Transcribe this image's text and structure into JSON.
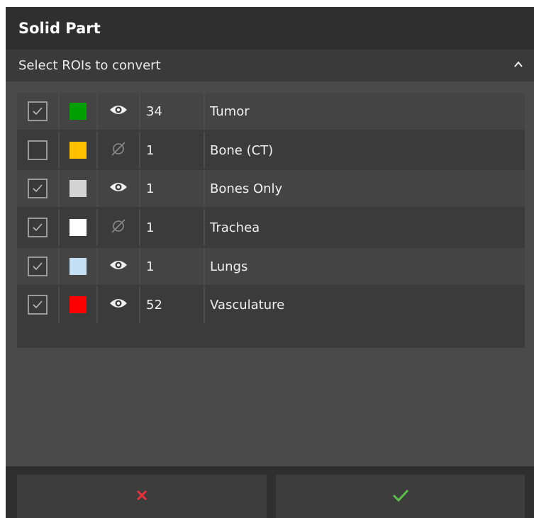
{
  "panel": {
    "title": "Solid Part"
  },
  "section": {
    "label": "Select ROIs to convert",
    "collapse_icon": "chevron-up-icon"
  },
  "rois": [
    {
      "checked": true,
      "color": "#00a000",
      "visible": true,
      "count": "34",
      "name": "Tumor"
    },
    {
      "checked": false,
      "color": "#ffc000",
      "visible": false,
      "count": "1",
      "name": "Bone (CT)"
    },
    {
      "checked": true,
      "color": "#d3d3d3",
      "visible": true,
      "count": "1",
      "name": "Bones Only"
    },
    {
      "checked": true,
      "color": "#ffffff",
      "visible": false,
      "count": "1",
      "name": "Trachea"
    },
    {
      "checked": true,
      "color": "#c5e0f5",
      "visible": true,
      "count": "1",
      "name": "Lungs"
    },
    {
      "checked": true,
      "color": "#ff0000",
      "visible": true,
      "count": "52",
      "name": "Vasculature"
    }
  ],
  "buttons": {
    "cancel": {
      "icon": "close-icon",
      "color": "#e8313b"
    },
    "ok": {
      "icon": "checkmark-icon",
      "color": "#5bbf4a"
    }
  }
}
